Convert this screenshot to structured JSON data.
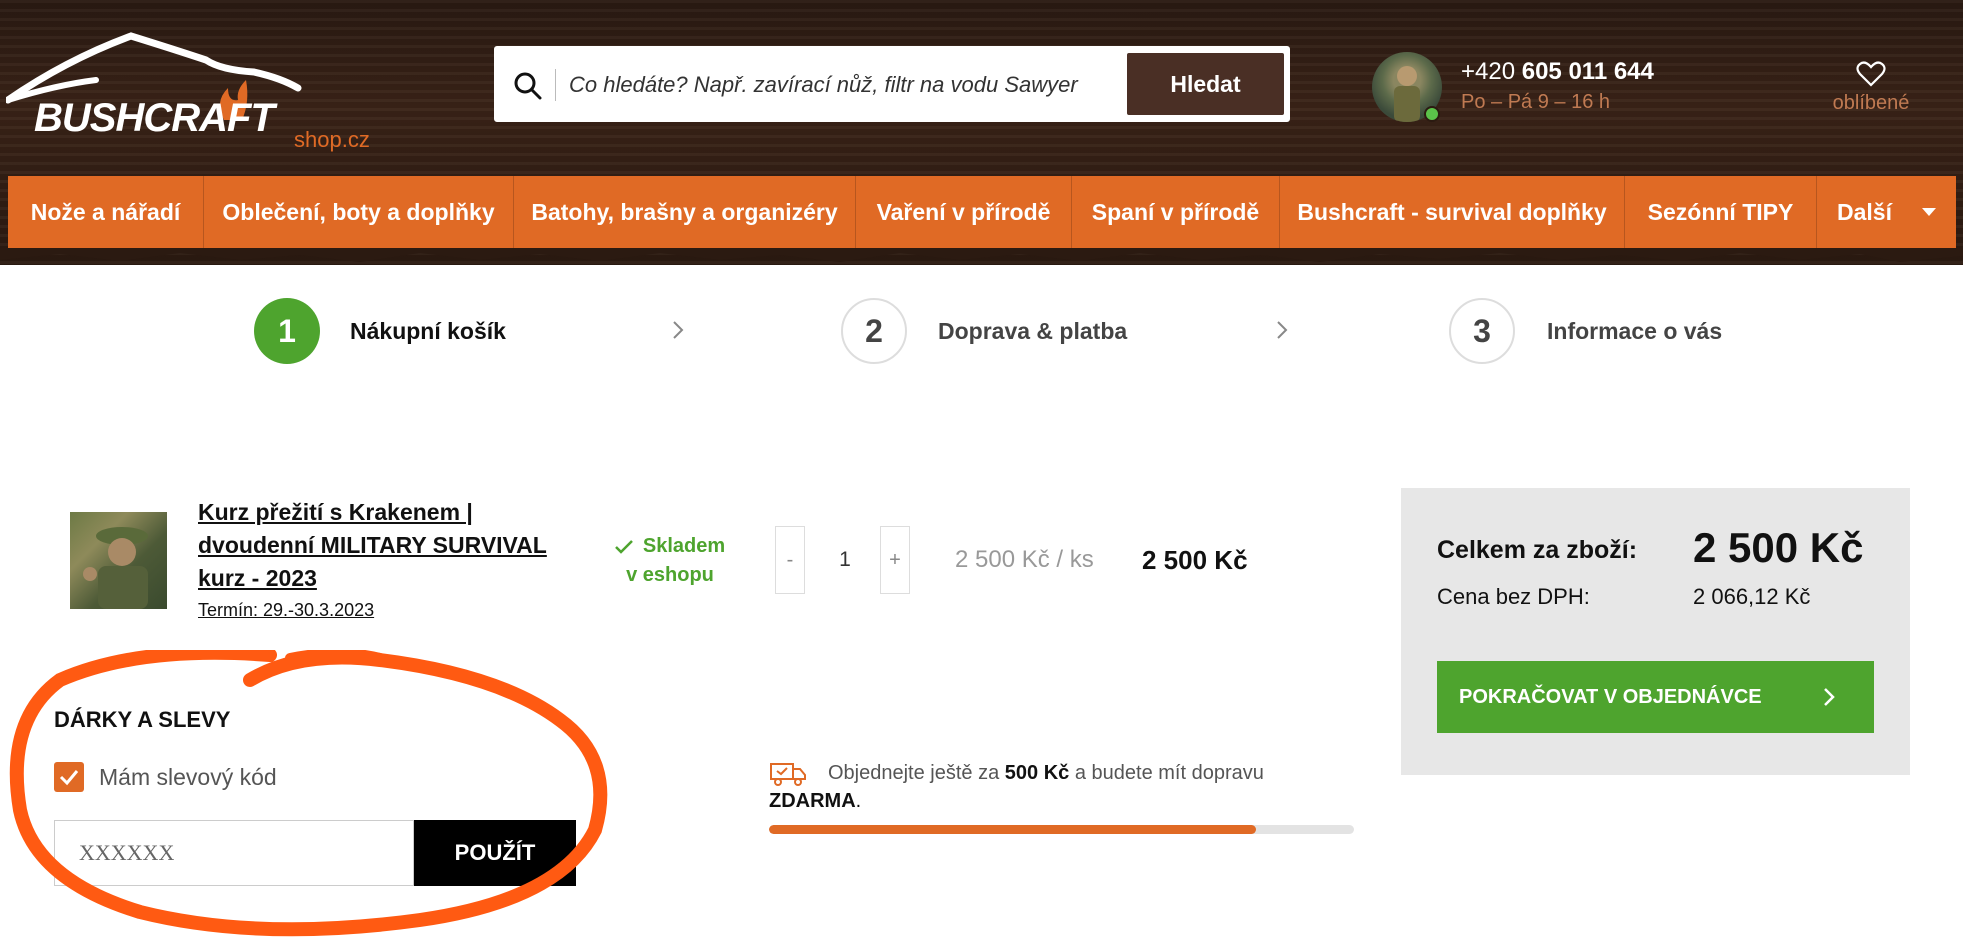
{
  "header": {
    "logo_text": "BUSHCRAFT",
    "logo_suffix": "shop.cz",
    "search": {
      "placeholder": "Co hledáte? Např. zavírací nůž, filtr na vodu Sawyer",
      "button_label": "Hledat"
    },
    "contact": {
      "phone_prefix": "+420 ",
      "phone_number": "605 011 644",
      "hours": "Po – Pá 9 – 16 h"
    },
    "favorites_label": "oblíbené"
  },
  "nav": {
    "items": [
      {
        "label": "Nože a nářadí"
      },
      {
        "label": "Oblečení, boty a doplňky"
      },
      {
        "label": "Batohy, brašny a organizéry"
      },
      {
        "label": "Vaření v přírodě"
      },
      {
        "label": "Spaní v přírodě"
      },
      {
        "label": "Bushcraft - survival doplňky"
      },
      {
        "label": "Sezónní TIPY"
      },
      {
        "label": "Další"
      }
    ]
  },
  "steps": [
    {
      "number": "1",
      "label": "Nákupní košík"
    },
    {
      "number": "2",
      "label": "Doprava & platba"
    },
    {
      "number": "3",
      "label": "Informace o vás"
    }
  ],
  "cart": {
    "product": {
      "name": "Kurz přežití s Krakenem | dvoudenní MILITARY SURVIVAL kurz - 2023",
      "term": "Termín: 29.-30.3.2023",
      "stock_line1": "Skladem",
      "stock_line2": "v eshopu",
      "qty_minus": "-",
      "qty": "1",
      "qty_plus": "+",
      "unit_price": "2 500 Kč / ks",
      "total": "2 500 Kč"
    }
  },
  "summary": {
    "total_label": "Celkem za zboží:",
    "total_value": "2 500 Kč",
    "net_label": "Cena bez DPH:",
    "net_value": "2 066,12 Kč",
    "continue_label": "POKRAČOVAT V OBJEDNÁVCE"
  },
  "shipping": {
    "text_before": "Objednejte ještě za ",
    "amount": "500 Kč",
    "text_after": " a budete mít dopravu",
    "free": "ZDARMA",
    "free_suffix": ".",
    "progress": 0.833
  },
  "gifts": {
    "title": "DÁRKY A SLEVY",
    "checkbox_label": "Mám slevový kód",
    "checkbox_checked": true,
    "code_placeholder": "XXXXXX",
    "apply_label": "POUŽÍT"
  },
  "colors": {
    "brand_orange": "#e06a25",
    "green": "#4ea42e",
    "dark_brown": "#4a2f25",
    "annotation": "#ff5a12"
  }
}
